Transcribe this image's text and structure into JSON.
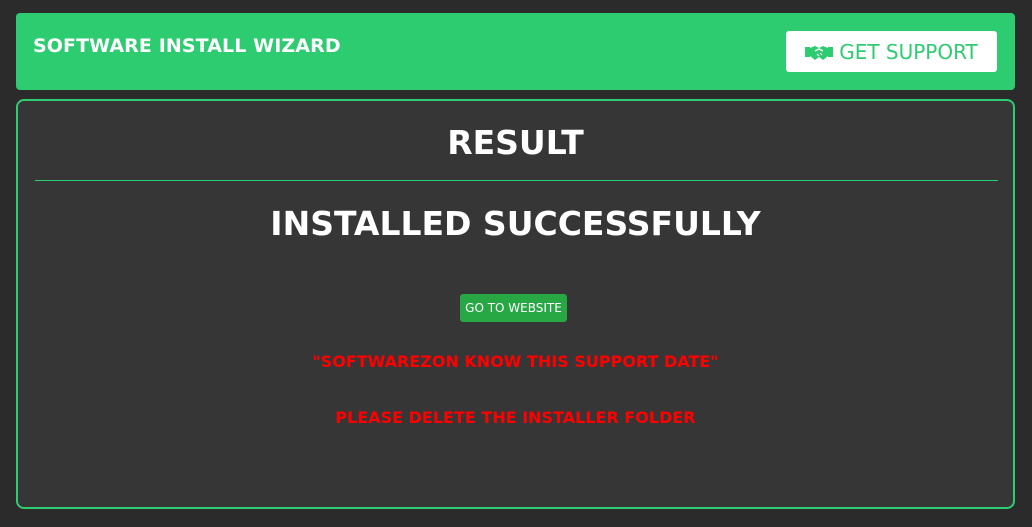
{
  "header": {
    "title": "SOFTWARE INSTALL WIZARD",
    "support_label": "GET SUPPORT",
    "support_icon": "handshake-icon"
  },
  "panel": {
    "title": "RESULT",
    "status": "INSTALLED SUCCESSFULLY",
    "website_button": "GO TO WEBSITE",
    "warning_support": "\"SOFTWAREZON KNOW THIS SUPPORT DATE\"",
    "warning_delete": "PLEASE DELETE THE INSTALLER FOLDER"
  },
  "colors": {
    "background": "#2b2b2b",
    "panel": "#363636",
    "accent": "#2ecc71",
    "button_green": "#28a745",
    "warning": "#ff0000"
  }
}
